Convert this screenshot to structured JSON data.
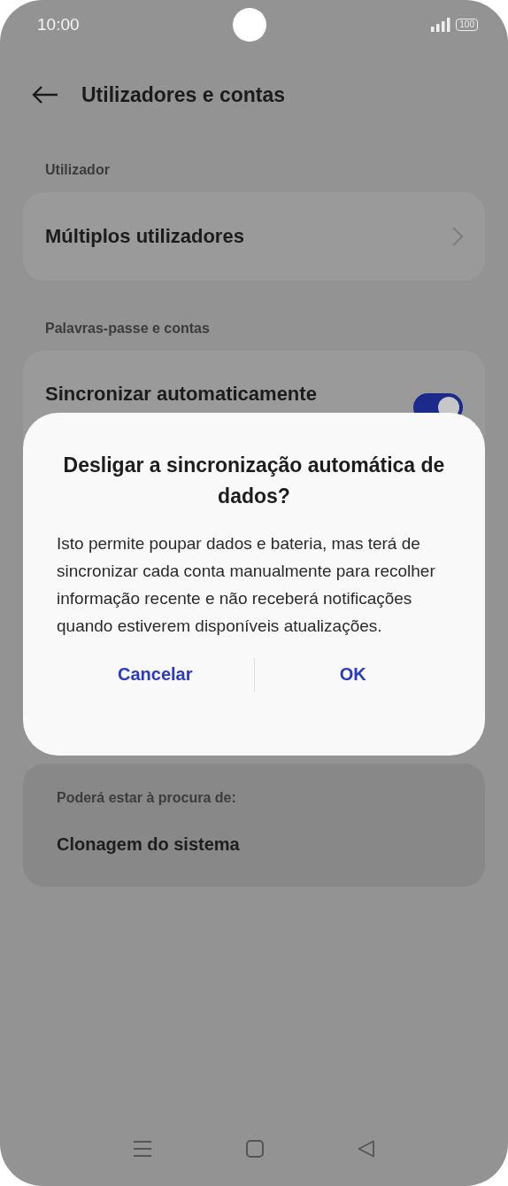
{
  "status_bar": {
    "time": "10:00",
    "battery": "100"
  },
  "header": {
    "title": "Utilizadores e contas"
  },
  "sections": [
    {
      "label": "Utilizador",
      "items": [
        {
          "kind": "link",
          "title": "Múltiplos utilizadores"
        }
      ]
    },
    {
      "label": "Palavras-passe e contas",
      "items": [
        {
          "kind": "toggle",
          "title": "Sincronizar automaticamente",
          "on": true
        }
      ]
    }
  ],
  "suggestions": {
    "label": "Poderá estar à procura de:",
    "items": [
      "Clonagem do sistema"
    ]
  },
  "dialog": {
    "title": "Desligar a sincronização automática de dados?",
    "message": "Isto permite poupar dados e bateria, mas terá de sincronizar cada conta manualmente para recolher informação recente e não receberá notificações quando estiverem disponíveis atualizações.",
    "buttons": [
      "Cancelar",
      "OK"
    ]
  }
}
